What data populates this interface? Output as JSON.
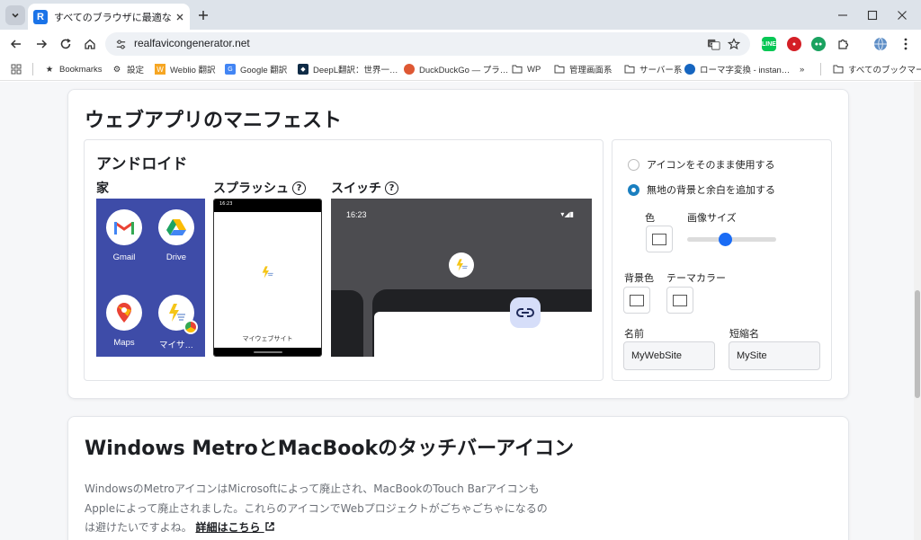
{
  "browser": {
    "tab_title": "すべてのブラウザに最適なアイコンを",
    "url": "realfavicongenerator.net",
    "bookmarks": [
      "Bookmarks",
      "設定",
      "Weblio 翻訳",
      "Google 翻訳",
      "DeepL翻訳：世界一…",
      "DuckDuckGo — プラ…",
      "WP",
      "管理画面系",
      "サーバー系",
      "ローマ字変換 - instan…"
    ],
    "all_bookmarks": "すべてのブックマーク",
    "colors": {
      "tabstrip": "#dde3ea",
      "accent": "#1a73e8"
    }
  },
  "manifest": {
    "title": "ウェブアプリのマニフェスト",
    "android": {
      "title": "アンドロイド",
      "home_label": "家",
      "splash_label": "スプラッシュ",
      "switch_label": "スイッチ",
      "apps": [
        "Gmail",
        "Drive",
        "Maps",
        "マイサ…"
      ],
      "splash_app_name": "マイウェブサイト",
      "switch_time": "16:23"
    },
    "settings": {
      "option_as_is": "アイコンをそのまま使用する",
      "option_add_bg": "無地の背景と余白を追加する",
      "color_label": "色",
      "image_size_label": "画像サイズ",
      "image_size_value": 0.42,
      "bg_color_label": "背景色",
      "theme_color_label": "テーマカラー",
      "name_label": "名前",
      "short_name_label": "短縮名",
      "name_value": "MyWebSite",
      "short_name_value": "MySite"
    }
  },
  "metro": {
    "title": "Windows MetroとMacBookのタッチバーアイコン",
    "description": "WindowsのMetroアイコンはMicrosoftによって廃止され、MacBookのTouch BarアイコンもAppleによって廃止されました。これらのアイコンでWebプロジェクトがごちゃごちゃになるのは避けたいですよね。",
    "link_text": "詳細はこちら"
  }
}
